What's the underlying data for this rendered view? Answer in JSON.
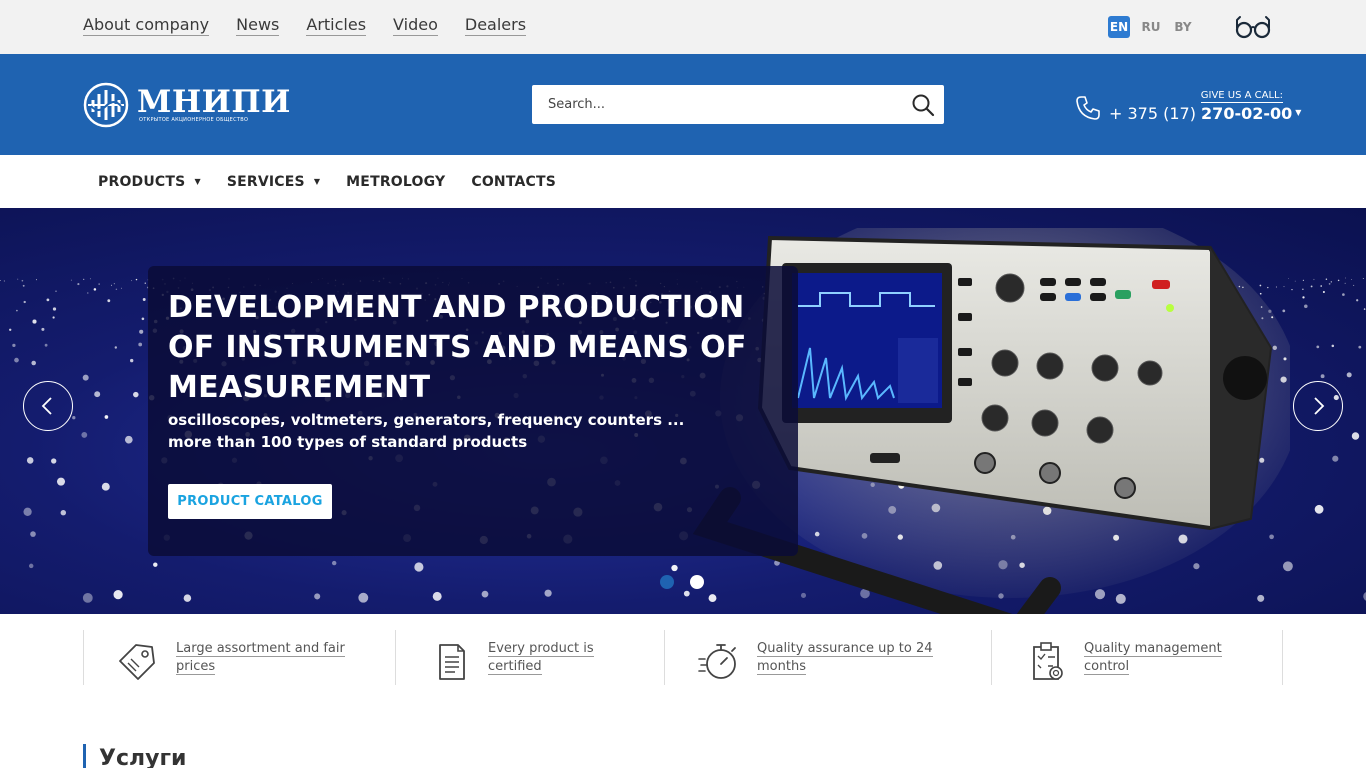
{
  "topbar": {
    "links": [
      "About company",
      "News",
      "Articles",
      "Video",
      "Dealers"
    ],
    "languages": [
      {
        "code": "EN",
        "active": true
      },
      {
        "code": "RU",
        "active": false
      },
      {
        "code": "BY",
        "active": false
      }
    ],
    "accessibility_icon": "glasses-icon"
  },
  "header": {
    "logo_name": "МНИПИ",
    "logo_subtitle": "ОТКРЫТОЕ АКЦИОНЕРНОЕ ОБЩЕСТВО",
    "search_placeholder": "Search...",
    "call_label": "GIVE US A CALL:",
    "phone_prefix": "+ 375 (17) ",
    "phone_number": "270-02-00"
  },
  "mainnav": {
    "items": [
      {
        "label": "PRODUCTS",
        "dropdown": true
      },
      {
        "label": "SERVICES",
        "dropdown": true
      },
      {
        "label": "METROLOGY",
        "dropdown": false
      },
      {
        "label": "CONTACTS",
        "dropdown": false
      }
    ]
  },
  "hero": {
    "title": "DEVELOPMENT AND PRODUCTION OF INSTRUMENTS AND MEANS OF MEASUREMENT",
    "subtitle_line1": "oscilloscopes, voltmeters, generators, frequency counters ...",
    "subtitle_line2": "more than 100 types of standard products",
    "button_label": "PRODUCT CATALOG",
    "slides_total": 2,
    "slide_active": 1
  },
  "features": [
    {
      "icon": "price-tag-icon",
      "text": "Large assortment and fair prices"
    },
    {
      "icon": "certificate-document-icon",
      "text": "Every product is certified"
    },
    {
      "icon": "stopwatch-icon",
      "text": "Quality assurance up to 24 months"
    },
    {
      "icon": "clipboard-checklist-icon",
      "text": "Quality management control"
    }
  ],
  "section": {
    "title": "Услуги"
  },
  "colors": {
    "brand_blue": "#1f63b1",
    "hero_bg": "#141c6e",
    "accent_cyan": "#1aa3e0",
    "topbar_bg": "#f2f2f2"
  }
}
